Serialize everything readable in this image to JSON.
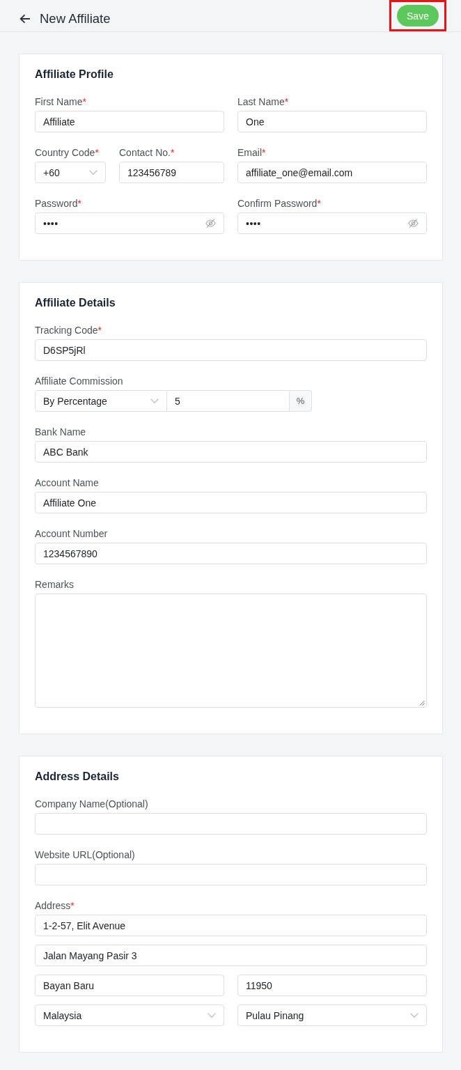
{
  "header": {
    "title": "New Affiliate",
    "save_button": {
      "label": "Save",
      "highlighted": true
    }
  },
  "sections": [
    {
      "title": "Affiliate Profile",
      "rows": [
        {
          "kind": "pair",
          "fields": [
            {
              "kind": "text",
              "label": "First Name",
              "required_mark": "*",
              "value": "Affiliate"
            },
            {
              "kind": "text",
              "label": "Last Name",
              "required_mark": "*",
              "value": "One"
            }
          ]
        },
        {
          "kind": "phone",
          "fields": [
            {
              "kind": "select",
              "label": "Country Code",
              "required_mark": "*",
              "value": "+60"
            },
            {
              "kind": "text",
              "label": "Contact No.",
              "required_mark": "*",
              "value": "123456789"
            },
            {
              "kind": "text",
              "label": "Email",
              "required_mark": "*",
              "value": "affiliate_one@email.com"
            }
          ]
        },
        {
          "kind": "pair",
          "fields": [
            {
              "kind": "password",
              "label": "Password",
              "required_mark": "*",
              "value": "••••"
            },
            {
              "kind": "password",
              "label": "Confirm Password",
              "required_mark": "*",
              "value": "••••"
            }
          ]
        }
      ]
    },
    {
      "title": "Affiliate Details",
      "rows": [
        {
          "kind": "full",
          "fields": [
            {
              "kind": "text",
              "label": "Tracking Code",
              "required_mark": "*",
              "value": "D6SP5jRl"
            }
          ]
        },
        {
          "kind": "full",
          "fields": [
            {
              "kind": "commission",
              "label": "Affiliate Commission",
              "mode": "By Percentage",
              "value": "5",
              "unit": "%"
            }
          ]
        },
        {
          "kind": "full",
          "fields": [
            {
              "kind": "text",
              "label": "Bank Name",
              "value": "ABC Bank"
            }
          ]
        },
        {
          "kind": "full",
          "fields": [
            {
              "kind": "text",
              "label": "Account Name",
              "value": "Affiliate One"
            }
          ]
        },
        {
          "kind": "full",
          "fields": [
            {
              "kind": "text",
              "label": "Account Number",
              "value": "1234567890"
            }
          ]
        },
        {
          "kind": "full",
          "fields": [
            {
              "kind": "textarea",
              "label": "Remarks"
            }
          ]
        }
      ]
    },
    {
      "title": "Address Details",
      "rows": [
        {
          "kind": "full",
          "fields": [
            {
              "kind": "text",
              "label": "Company Name(Optional)"
            }
          ]
        },
        {
          "kind": "full",
          "fields": [
            {
              "kind": "text",
              "label": "Website URL(Optional)"
            }
          ]
        },
        {
          "kind": "full",
          "fields": [
            {
              "kind": "text",
              "label": "Address",
              "required_mark": "*",
              "value": "1-2-57, Elit Avenue"
            }
          ]
        },
        {
          "kind": "full",
          "fields": [
            {
              "kind": "text",
              "value": "Jalan Mayang Pasir 3"
            }
          ]
        },
        {
          "kind": "pair",
          "fields": [
            {
              "kind": "text",
              "value": "Bayan Baru"
            },
            {
              "kind": "text",
              "value": "11950"
            }
          ]
        },
        {
          "kind": "pair",
          "fields": [
            {
              "kind": "select",
              "value": "Malaysia"
            },
            {
              "kind": "select",
              "value": "Pulau Pinang"
            }
          ]
        }
      ]
    }
  ]
}
